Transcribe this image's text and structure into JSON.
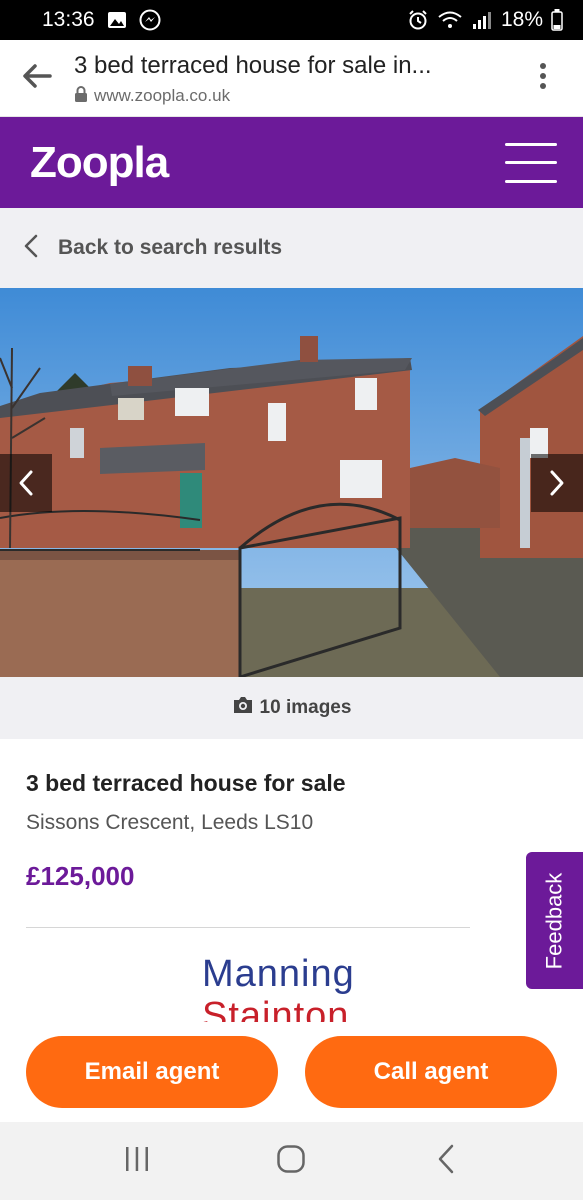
{
  "status_bar": {
    "time": "13:36",
    "battery": "18%",
    "icons": [
      "gallery-icon",
      "messenger-icon",
      "alarm-icon",
      "wifi-icon",
      "signal-icon",
      "battery-icon"
    ]
  },
  "browser": {
    "page_title": "3 bed terraced house for sale in...",
    "url": "www.zoopla.co.uk"
  },
  "header": {
    "logo": "Zoopla",
    "brand_color": "#6c1a99"
  },
  "navigation": {
    "back_label": "Back to search results"
  },
  "gallery": {
    "image_count_label": "10 images"
  },
  "listing": {
    "title": "3 bed terraced house for sale",
    "address": "Sissons Crescent, Leeds LS10",
    "price": "£125,000"
  },
  "agent": {
    "name_line1": "Manning",
    "name_line2": "Stainton"
  },
  "feedback": {
    "label": "Feedback"
  },
  "actions": {
    "email_label": "Email agent",
    "call_label": "Call agent",
    "accent_color": "#ff6a11"
  }
}
